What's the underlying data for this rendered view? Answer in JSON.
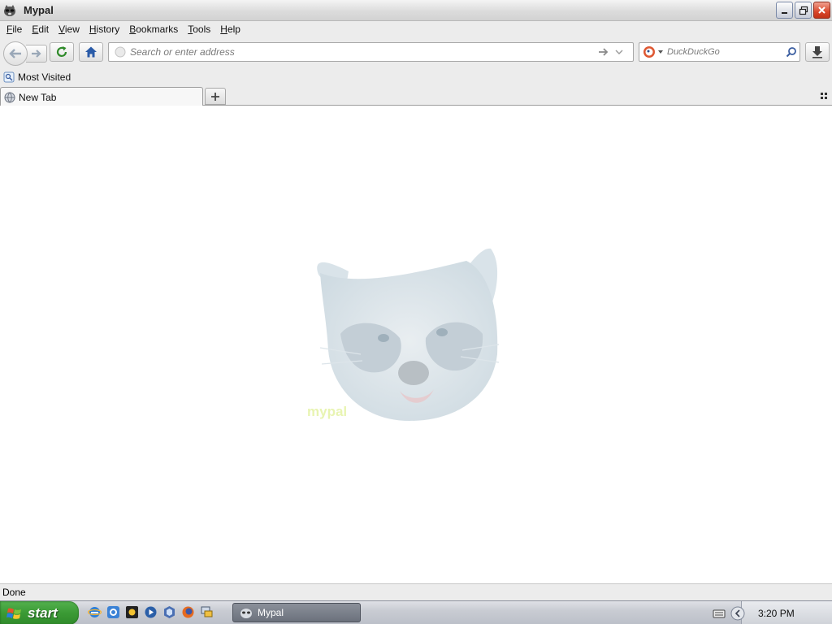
{
  "window": {
    "title": "Mypal"
  },
  "menu": {
    "items": [
      "File",
      "Edit",
      "View",
      "History",
      "Bookmarks",
      "Tools",
      "Help"
    ]
  },
  "navbar": {
    "url_placeholder": "Search or enter address",
    "search_placeholder": "DuckDuckGo"
  },
  "bookmarks": {
    "items": [
      {
        "label": "Most Visited",
        "icon": "bookmarks-folder-icon"
      }
    ]
  },
  "tabs": [
    {
      "label": "New Tab",
      "icon": "globe-icon"
    }
  ],
  "content": {
    "logo": "mypal-raccoon-logo",
    "logo_text": "mypal"
  },
  "status": {
    "text": "Done"
  },
  "taskbar": {
    "start_label": "start",
    "task_label": "Mypal",
    "clock": "3:20 PM",
    "quick_launch_icons": [
      "internet-explorer-icon",
      "browser-icon",
      "media-icon",
      "play-icon",
      "vpn-icon",
      "firefox-icon",
      "network-icon"
    ]
  }
}
